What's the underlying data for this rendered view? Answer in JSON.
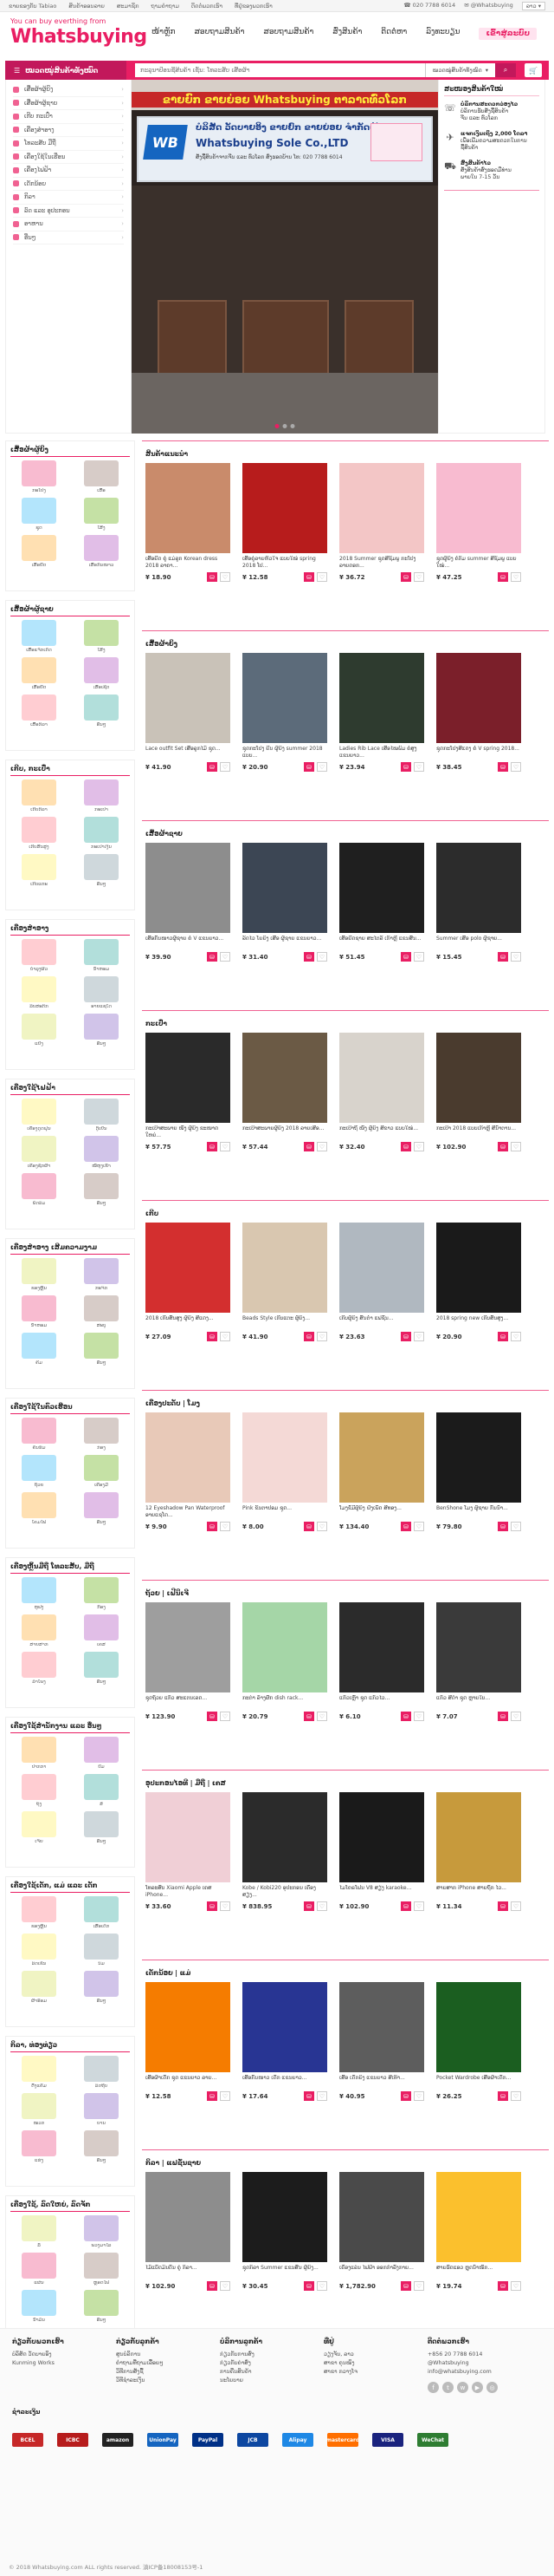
{
  "topbar": {
    "items": [
      "ຂາຍຂອງກັບ Tabiao",
      "ສິນຄ້າອອນລາຍ",
      "ສະມາຊິກ",
      "ຖາມຄໍາຖາມ",
      "ຕິດຕໍ່ພວກເຮົາ",
      "ທີ່ຢູ່ຂອງພວກເຮົາ"
    ],
    "phone": "020 7788 6014",
    "account": "@Whatsbuying",
    "lang": "ລາວ"
  },
  "header": {
    "tagline": "You can buy everthing from",
    "logo": "Whatsbuying",
    "nav": [
      "ໜ້າຫຼັກ",
      "ສອບຖາມສິນຄ້າ",
      "ສອບຖາມສິນຄ້າ",
      "ສົ່ງສິນຄ້າ",
      "ຕິດຕໍ່ຫາ",
      "ລົງທະບຽນ"
    ],
    "nav_active": "ເຂົ້າສູ່ລະບົບ"
  },
  "search": {
    "category_button": "ໝວດໝູ່ສິນຄ້າທັງໝົດ",
    "placeholder": "ກະລຸນາປ້ອນຊື່ສິນຄ້າ ເຊັ່ນ: ໂທລະສັບ ເສື້ອຜ້າ",
    "category_select": "ໝວດໝູ່ສິນຄ້າທັງໝົດ"
  },
  "sidebar": {
    "items": [
      "ເສື້ອຜ້າຜູ້ຍິງ",
      "ເສື້ອຜ້າຜູ້ຊາຍ",
      "ເກີບ ກະເປົ໋າ",
      "ເຄື່ອງສໍາອາງ",
      "ໂທລະສັບ ມືຖື",
      "ເຄື່ອງໃຊ້ໃນເຮືອນ",
      "ເຄື່ອງໄຟຟ້າ",
      "ເດັກນ້ອຍ",
      "ກິລາ",
      "ລົດ ແລະ ອຸປະກອນ",
      "ອາຫານ",
      "ອື່ນໆ"
    ]
  },
  "banner": {
    "red_sign": "ຂາຍຍົກ ຂາຍຍ່ອຍ Whatsbuying ຕາລາດທົ່ວໂລກ",
    "brand_text": "WB",
    "line1": "ບໍລິສັດ ວັດບາຍອິງ ຂາຍຍົກ ຂາຍຍ່ອຍ ຈໍາກັດຜູ້ດຽວ",
    "line2": "Whatsbuying Sole Co.,LTD",
    "line3": "ສັ່ງຊື້ສິນຄ້າຈາກຈີນ ແລະ ທົ່ວໂລກ ສົ່ງຮອດບ້ານ ໂທ: 020 7788 6014"
  },
  "news": {
    "title": "ສະໜອງສິນຄ້າໃໝ່",
    "services": [
      {
        "title": "ບໍລິການສະດວກວ່ອງໄວ",
        "lines": [
          "ບໍລິການຮັບສັ່ງຊື້ສິນຄ້າ",
          "ຈີນ ແລະ ທົ່ວໂລກ"
        ]
      },
      {
        "title": "ແຈກເງິນເຖິງ 2,000 ໂດລາ",
        "lines": [
          "ເພື່ອເພີ່ມຄວາມສະດວກໃນການ",
          "ຊື້ສິນຄ້າ"
        ]
      },
      {
        "title": "ສົ່ງສິນຄ້າໄວ",
        "lines": [
          "ສັ່ງສິນຄ້າສົ່ງຮອດມືທ່ານ",
          "ພາຍໃນ 7-15 ວັນ"
        ]
      }
    ]
  },
  "left_boxes": [
    {
      "title": "ເສື້ອຜ້າຜູ້ຍິງ",
      "cells": [
        "ກະໂປງ",
        "ເສື້ອ",
        "ຊຸດ",
        "ໂສ້ງ",
        "ເສື້ອຍືດ",
        "ເສື້ອກັນໜາວ"
      ]
    },
    {
      "title": "ເສື້ອຜ້າຜູ້ຊາຍ",
      "cells": [
        "ເສື້ອແຈັກເກັດ",
        "ໂສ້ງ",
        "ເສື້ອຍືດ",
        "ເສື້ອເຊີດ",
        "ເສື້ອກິລາ",
        "ອື່ນໆ"
      ]
    },
    {
      "title": "ເກີບ, ກະເປົ໋າ",
      "cells": [
        "ເກີບກິລາ",
        "ກະເປົ໋າ",
        "ເກີບສົ້ນສູງ",
        "ກະເປົ໋າເງິນ",
        "ເກີບແຕະ",
        "ອື່ນໆ"
      ]
    },
    {
      "title": "ເຄື່ອງສໍາອາງ",
      "cells": [
        "ບໍາລຸງຜິວ",
        "ນໍ້າຫອມ",
        "ລິບສະຕິກ",
        "ອາຍແຊໂດ",
        "ແປ້ງ",
        "ອື່ນໆ"
      ]
    },
    {
      "title": "ເຄື່ອງໃຊ້ໄຟຟ້າ",
      "cells": [
        "ເຄື່ອງດູດຝຸ່ນ",
        "ຕູ້ເຢັນ",
        "ເຄື່ອງຊັກຜ້າ",
        "ໝໍ້ຫຸງເຂົ້າ",
        "ພັດລົມ",
        "ອື່ນໆ"
      ]
    },
    {
      "title": "ເຄື່ອງສໍາອາງ ເສີມຄວາມງາມ",
      "cells": [
        "ຂອງຫຼິ້ນ",
        "ກະຈົກ",
        "ນໍ້າຫອມ",
        "ສະບູ",
        "ຄີມ",
        "ອື່ນໆ"
      ]
    },
    {
      "title": "ເຄື່ອງໃຊ້ໃນຄົວເຮືອນ",
      "cells": [
        "ຄັນຮົ່ມ",
        "ກ່ອງ",
        "ຖ້ວຍ",
        "ເຄື່ອງມື",
        "ໂຄມໄຟ",
        "ອື່ນໆ"
      ]
    },
    {
      "title": "ເຄື່ອງຫຼິ້ນມືຖື ໂທລະສັບ, ມືຖື",
      "cells": [
        "ຫູຟັງ",
        "ກ້ອງ",
        "ສາຍສາກ",
        "ເຄສ",
        "ລໍາໂພງ",
        "ອື່ນໆ"
      ]
    },
    {
      "title": "ເຄື່ອງໃຊ້ສໍານັກງານ ແລະ ອື່ນໆ",
      "cells": [
        "ປາກກາ",
        "ປຶ້ມ",
        "ຖົງ",
        "ສໍ",
        "ເຈ້ຍ",
        "ອື່ນໆ"
      ]
    },
    {
      "title": "ເຄື່ອງໃຊ້ເດັກ, ແມ່ ແລະ ເດັກ",
      "cells": [
        "ຂອງຫຼິ້ນ",
        "ເສື້ອເດັກ",
        "ລົດເຂັນ",
        "ນົມ",
        "ຜ້າອ້ອມ",
        "ອື່ນໆ"
      ]
    },
    {
      "title": "ກິລາ, ທ່ອງທ່ຽວ",
      "cells": [
        "ຕັ້ງແຄ້ມ",
        "ລົດຖີບ",
        "ໝວກ",
        "ບານ",
        "ແຮ່ງ",
        "ອື່ນໆ"
      ]
    },
    {
      "title": "ເຄື່ອງໃຊ້, ລົດໃຫຍ່, ລົດຈັກ",
      "cells": [
        "ລໍ້",
        "ພວງມາໄລ",
        "ແຜ່ນ",
        "ຫຼອດໄຟ",
        "ນໍ້າມັນ",
        "ອື່ນໆ"
      ]
    }
  ],
  "sections": [
    {
      "title": "ສິນຄ້າແນະນໍາ",
      "products": [
        {
          "name": "ເສື້ອຍືດ ຄູ່ ແມ່ລູກ Korean dress 2018 ລາຄາ...",
          "price": "¥ 18.90"
        },
        {
          "name": "ເສື້ອຄູ່ລາຍຫົວໃຈ ແບບໃໝ່ spring 2018 ໂປ...",
          "price": "¥ 12.58"
        },
        {
          "name": "2018 Summer ຊຸດສີຊົມພູ ກະໂປງ ລາຍດອກ...",
          "price": "¥ 36.72"
        },
        {
          "name": "ຊຸດຜູ້ຍິງ ຄໍກົມ summer ສີຊົມພູ ແບບໃໝ່...",
          "price": "¥ 47.25"
        }
      ]
    },
    {
      "title": "ເສື້ອຜ້າຍິງ",
      "products": [
        {
          "name": "Lace outfit Set ເສື້ອລູກໄມ້ ຊຸດ...",
          "price": "¥ 41.90"
        },
        {
          "name": "ຊຸດກະໂປງ ຍີນ ຜູ້ຍິງ summer 2018 ແບບ...",
          "price": "¥ 20.90"
        },
        {
          "name": "Ladies Rib Lace ເສື້ອໄໝພົມ ຄໍສູງ ແຂນຍາວ...",
          "price": "¥ 23.94"
        },
        {
          "name": "ຊຸດກະໂປງສີແດງ ຄໍ V spring 2018...",
          "price": "¥ 38.45"
        }
      ]
    },
    {
      "title": "ເສື້ອຜ້າຊາຍ",
      "products": [
        {
          "name": "ເສື້ອກັນໜາວຜູ້ຊາຍ ຄໍ V ແຂນຍາວ...",
          "price": "¥ 39.90"
        },
        {
          "name": "ລົດໄວ ໂຍຍິງ ເສື້ອ ຜູ້ຊາຍ ແຂນຍາວ...",
          "price": "¥ 31.40"
        },
        {
          "name": "ເສື້ອຍືດຊາຍ ສະໄຕລ໌ ເກົາຫຼີ ແຂນສັ້ນ...",
          "price": "¥ 51.45"
        },
        {
          "name": "Summer ເສື້ອ polo ຜູ້ຊາຍ...",
          "price": "¥ 15.45"
        }
      ]
    },
    {
      "title": "ກະເປົ໋າ",
      "products": [
        {
          "name": "ກະເປົ໋າສະພາຍ ໜັງ ຜູ້ຍິງ ຂະໜາດໃຫຍ່...",
          "price": "¥ 57.75"
        },
        {
          "name": "ກະເປົ໋າສະພາຍຜູ້ຍິງ 2018 ລາຍເສືອ...",
          "price": "¥ 57.44"
        },
        {
          "name": "ກະເປົ໋າຖື ໜັງ ຜູ້ຍິງ ສີຂາວ ແບບໃໝ່...",
          "price": "¥ 32.40"
        },
        {
          "name": "ກະເປົ໋າ 2018 ແບບເກົາຫຼີ ສີນໍ້າຕານ...",
          "price": "¥ 102.90"
        }
      ]
    },
    {
      "title": "ເກີບ",
      "products": [
        {
          "name": "2018 ເກີບສົ້ນສູງ ຜູ້ຍິງ ສີແດງ...",
          "price": "¥ 27.09"
        },
        {
          "name": "Beads Style ເກີບແຕະ ຜູ້ຍິງ...",
          "price": "¥ 41.90"
        },
        {
          "name": "ເກີບຜູ້ຍິງ ສົ້ນຕໍ່າ ແຟຊັນ...",
          "price": "¥ 23.63"
        },
        {
          "name": "2018 spring new ເກີບສົ້ນສູງ...",
          "price": "¥ 20.90"
        }
      ]
    },
    {
      "title": "ເຄື່ອງປະດັບ | ໂມງ",
      "products": [
        {
          "name": "12 Eyeshadow Pan Waterproof ອາຍແຊໂດ...",
          "price": "¥ 9.90"
        },
        {
          "name": "Pink ຂົນຕາປອມ ຊຸດ...",
          "price": "¥ 8.00"
        },
        {
          "name": "ໂມງຂໍ້ມືຜູ້ຍິງ ຝັງເພັດ ສີທອງ...",
          "price": "¥ 134.40"
        },
        {
          "name": "BenShone ໂມງ ຜູ້ຊາຍ ກັນນໍ້າ...",
          "price": "¥ 79.80"
        }
      ]
    },
    {
      "title": "ຖ້ວຍ | ເຟີນິເຈີ",
      "products": [
        {
          "name": "ຊຸດຖ້ວຍ ແກ້ວ ສະແຕນເລດ...",
          "price": "¥ 123.90"
        },
        {
          "name": "ກະຕ່າ ລ້າງຜັກ dish rack...",
          "price": "¥ 20.79"
        },
        {
          "name": "ແກ້ວເຫຼົ້າ ຊຸດ ແກ້ວໄວ...",
          "price": "¥ 6.10"
        },
        {
          "name": "ແກ້ວ ສີດໍາ ຊຸດ ຫຼາຍໃບ...",
          "price": "¥ 7.07"
        }
      ]
    },
    {
      "title": "ອຸປະກອນໄອທີ | ມືຖື | ເຄສ",
      "products": [
        {
          "name": "ໂທລະສັບ Xiaomi Apple ເຄສ iPhone...",
          "price": "¥ 33.60"
        },
        {
          "name": "Kobe / Kobi220 ອຸປະກອນ ເຄື່ອງສຽງ...",
          "price": "¥ 838.95"
        },
        {
          "name": "ໄມໂຄຣໂຟນ V8 ສຽງ karaoke...",
          "price": "¥ 102.90"
        },
        {
          "name": "ສາຍສາກ iPhone ສາຍຖັກ ໄວ...",
          "price": "¥ 11.34"
        }
      ]
    },
    {
      "title": "ເດັກນ້ອຍ | ແມ່",
      "products": [
        {
          "name": "ເສື້ອຜ້າເດັກ ຊຸດ ແຂນຍາວ ລາຍ...",
          "price": "¥ 12.58"
        },
        {
          "name": "ເສື້ອກັນໜາວ ເດັກ ແຂນຍາວ...",
          "price": "¥ 17.64"
        },
        {
          "name": "ເສື້ອ ເດັກຍິງ ແຂນຍາວ ສີເທົາ...",
          "price": "¥ 40.95"
        },
        {
          "name": "Pocket Wardrobe ເສື້ອຜ້າເດັກ...",
          "price": "¥ 26.25"
        }
      ]
    },
    {
      "title": "ກິລາ | ແຟຊັ່ນຊາຍ",
      "products": [
        {
          "name": "ໄມ້ແບັດມິນຕັນ ຄູ່ ກິລາ...",
          "price": "¥ 102.90"
        },
        {
          "name": "ຊຸດກິລາ Summer ແຂນສັ້ນ ຜູ້ຍິງ...",
          "price": "¥ 30.45"
        },
        {
          "name": "ເຄື່ອງແລ່ນ ໄຟຟ້າ ອອກກໍາລັງກາຍ...",
          "price": "¥ 1,782.90"
        },
        {
          "name": "ສາຍຮັດແອວ ຫຼຸດນໍ້າໜັກ...",
          "price": "¥ 19.74"
        }
      ]
    }
  ],
  "footer": {
    "columns": [
      {
        "title": "ກ່ຽວກັບພວກເຮົາ",
        "links": [
          "ບໍລິສັດ ວັດບາຍອິງ",
          "Kunming Works"
        ]
      },
      {
        "title": "ກ່ຽວກັບລູກຄ້າ",
        "links": [
          "ສູນບໍລິການ",
          "ຄໍາຖາມທີ່ຖາມເລື້ອຍໆ",
          "ວິທີການສັ່ງຊື້",
          "ວິທີຊໍາລະເງິນ"
        ]
      },
      {
        "title": "ບໍລິການລູກຄ້າ",
        "links": [
          "ກ່ຽວກັບການສົ່ງ",
          "ກ່ຽວກັບຄ່າສົ່ງ",
          "ການຄືນສິນຄ້າ",
          "ນະໂຍບາຍ"
        ]
      },
      {
        "title": "ທີ່ຢູ່",
        "links": [
          "ວຽງຈັນ, ລາວ",
          "ສາຂາ ຄຸນໝິງ",
          "ສາຂາ ກວາງໂຈ"
        ]
      },
      {
        "title": "ຕິດຕໍ່ພວກເຮົາ",
        "links": [
          "+856 20 7788 6014",
          "@Whatsbuying",
          "info@whatsbuying.com"
        ]
      }
    ],
    "pay_title": "ຊໍາລະເງິນ",
    "payments": [
      "BCEL",
      "ICBC",
      "amazon",
      "UnionPay",
      "PayPal",
      "JCB",
      "Alipay",
      "mastercard",
      "VISA",
      "WeChat"
    ],
    "copyright": "© 2018 Whatsbuying.com ALL rights reserved. 滇ICP备18008153号-1"
  }
}
